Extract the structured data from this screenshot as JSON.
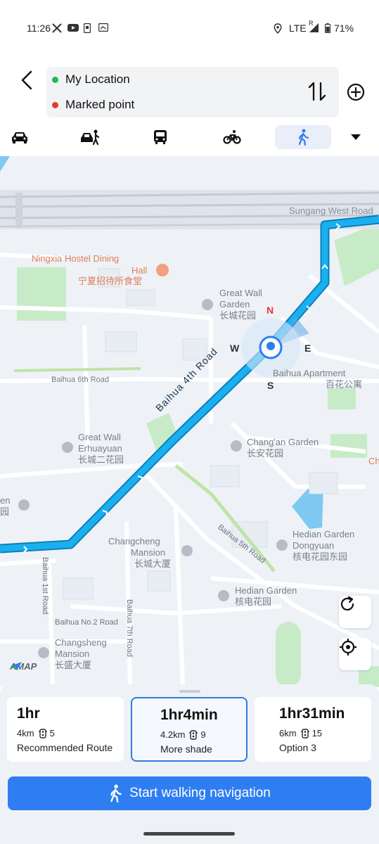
{
  "status_bar": {
    "time": "11:26",
    "network": "LTE",
    "roaming": "R",
    "battery": "71%"
  },
  "header": {
    "origin": "My Location",
    "destination": "Marked point",
    "origin_dot_color": "#1fb85a",
    "destination_dot_color": "#e53935"
  },
  "modes": [
    {
      "name": "car",
      "active": false
    },
    {
      "name": "taxi",
      "active": false
    },
    {
      "name": "bus",
      "active": false
    },
    {
      "name": "bike",
      "active": false
    },
    {
      "name": "walk",
      "active": true
    }
  ],
  "map": {
    "labels": {
      "sungang": "Sungang West Road",
      "ningxia_en_1": "Ningxia Hostel Dining",
      "ningxia_en_2": "Hall",
      "ningxia_cn": "宁夏招待所食堂",
      "greatwall_en_1": "Great Wall",
      "greatwall_en_2": "Garden",
      "greatwall_cn": "长城花园",
      "baihua_apt_en": "Baihua Apartment",
      "baihua_apt_cn": "百花公寓",
      "baihua6": "Baihua 6th Road",
      "baihua4": "Baihua 4th Road",
      "gw_erhua_en_1": "Great Wall",
      "gw_erhua_en_2": "Erhuayuan",
      "gw_erhua_cn": "长城二花园",
      "changan_en": "Chang'an Garden",
      "changan_cn": "长安花园",
      "edge_en": "en",
      "edge_cn": "园",
      "edge_ch": "Ch",
      "hedian_dong_en_1": "Hedian Garden",
      "hedian_dong_en_2": "Dongyuan",
      "hedian_dong_cn": "核电花园东园",
      "changcheng_en_1": "Changcheng",
      "changcheng_en_2": "Mansion",
      "changcheng_cn": "长城大厦",
      "baihua5": "Baihua 5th Road",
      "baihua1": "Baihua 1st Road",
      "hedian_en": "Hedian Garden",
      "hedian_cn": "核电花园",
      "baihua_no2": "Baihua No.2 Road",
      "baihua7": "Baihua 7th Road",
      "changsheng_en_1": "Changsheng",
      "changsheng_en_2": "Mansion",
      "changsheng_cn": "长盛大厦"
    },
    "compass": {
      "n": "N",
      "e": "E",
      "s": "S",
      "w": "W"
    },
    "brand": "AMAP",
    "route_color": "#1ab0f0"
  },
  "routes": [
    {
      "duration": "1hr",
      "distance": "4km",
      "lights": "5",
      "label": "Recommended Route",
      "selected": false
    },
    {
      "duration": "1hr4min",
      "distance": "4.2km",
      "lights": "9",
      "label": "More shade",
      "selected": true
    },
    {
      "duration": "1hr31min",
      "distance": "6km",
      "lights": "15",
      "label": "Option 3",
      "selected": false
    }
  ],
  "start_button": {
    "label": "Start walking navigation",
    "color": "#2e7ef2"
  }
}
